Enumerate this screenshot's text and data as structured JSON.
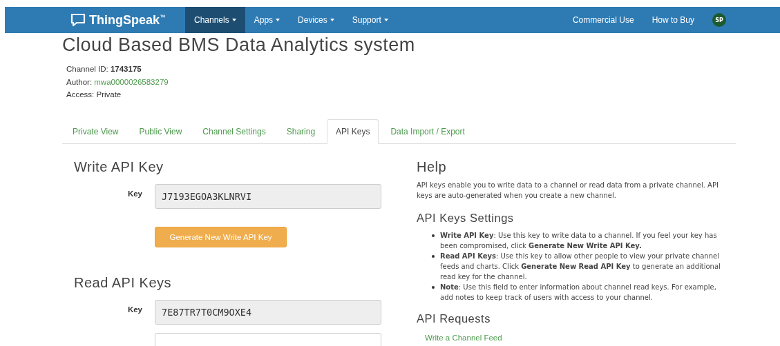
{
  "navbar": {
    "brand": "ThingSpeak",
    "trademark": "™",
    "menu": [
      {
        "label": "Channels",
        "selected": true
      },
      {
        "label": "Apps",
        "selected": false
      },
      {
        "label": "Devices",
        "selected": false
      },
      {
        "label": "Support",
        "selected": false
      }
    ],
    "links": [
      "Commercial Use",
      "How to Buy"
    ],
    "avatar": "SP"
  },
  "channel": {
    "title": "Cloud Based BMS Data Analytics system",
    "id_label": "Channel ID:",
    "id": "1743175",
    "author_label": "Author:",
    "author": "mwa0000026583279",
    "access_label": "Access:",
    "access": "Private"
  },
  "tabs": [
    {
      "label": "Private View",
      "selected": false
    },
    {
      "label": "Public View",
      "selected": false
    },
    {
      "label": "Channel Settings",
      "selected": false
    },
    {
      "label": "Sharing",
      "selected": false
    },
    {
      "label": "API Keys",
      "selected": true
    },
    {
      "label": "Data Import / Export",
      "selected": false
    }
  ],
  "write_api_key": {
    "heading": "Write API Key",
    "label": "Key",
    "value": "J7193EGOA3KLNRVI",
    "button": "Generate New Write API Key"
  },
  "read_api_keys": {
    "heading": "Read API Keys",
    "label": "Key",
    "value": "7E87TR7T0CM9OXE4"
  },
  "help": {
    "heading": "Help",
    "text": "API keys enable you to write data to a channel or read data from a private channel. API keys are auto-generated when you create a new channel.",
    "settings_heading": "API Keys Settings",
    "settings": [
      "**Write API Key**: Use this key to write data to a channel. If you feel your key has been compromised, click **Generate New Write API Key.**",
      "**Read API Keys**: Use this key to allow other people to view your private channel feeds and charts. Click **Generate New Read API Key** to generate an additional read key for the channel.",
      "**Note**: Use this field to enter information about channel read keys. For example, add notes to keep track of users with access to your channel."
    ],
    "requests_heading": "API Requests",
    "requests": [
      "Write a Channel Feed"
    ]
  }
}
